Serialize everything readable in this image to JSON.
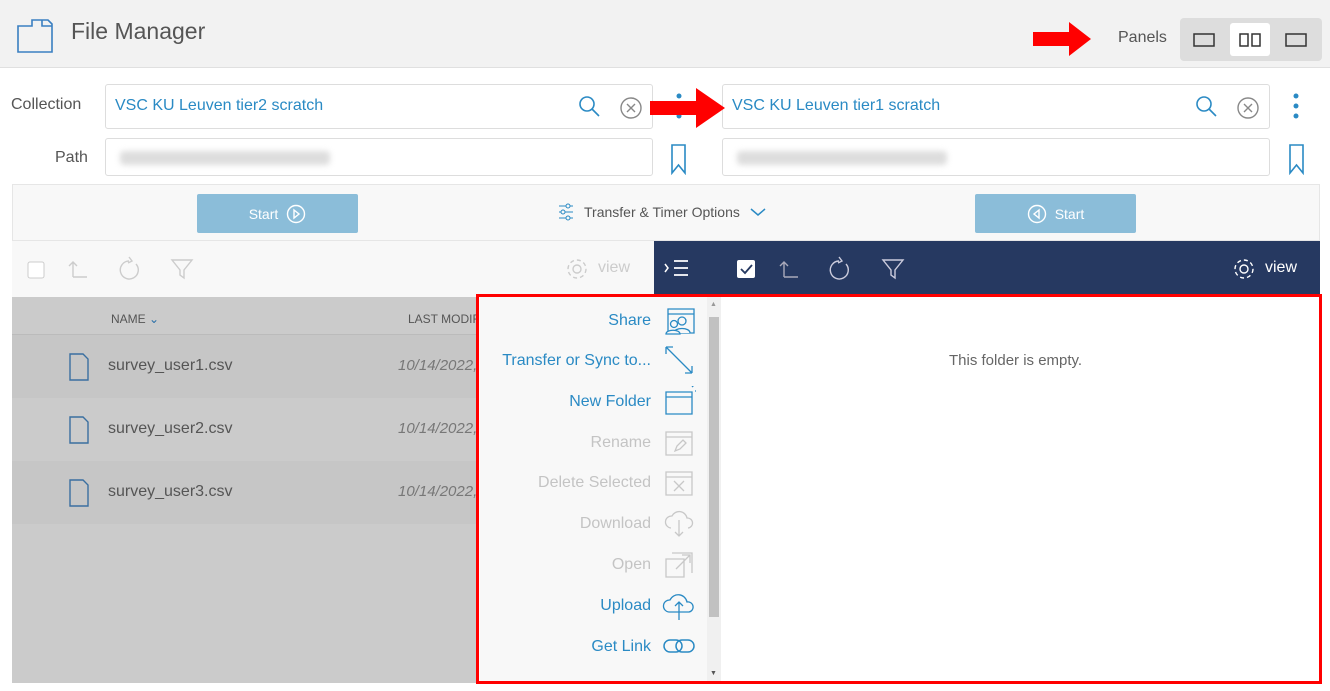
{
  "header": {
    "title": "File Manager",
    "panels_label": "Panels",
    "panel_modes": [
      "single-left",
      "dual",
      "single-right"
    ],
    "active_panel_mode": "dual"
  },
  "left": {
    "collection_label": "Collection",
    "collection": "VSC KU Leuven tier2 scratch",
    "path_label": "Path",
    "start_label": "Start",
    "toolbar": {
      "view_label": "view"
    },
    "columns": [
      "NAME",
      "LAST MODIF"
    ],
    "files": [
      {
        "name": "survey_user1.csv",
        "modified": "10/14/2022,"
      },
      {
        "name": "survey_user2.csv",
        "modified": "10/14/2022,"
      },
      {
        "name": "survey_user3.csv",
        "modified": "10/14/2022,"
      }
    ]
  },
  "transfer_options_label": "Transfer & Timer Options",
  "right": {
    "collection": "VSC KU Leuven tier1 scratch",
    "start_label": "Start",
    "toolbar": {
      "view_label": "view"
    },
    "empty_message": "This folder is empty."
  },
  "menu": [
    {
      "label": "Share",
      "enabled": true,
      "icon": "share-icon"
    },
    {
      "label": "Transfer or Sync to...",
      "enabled": true,
      "icon": "transfer-icon"
    },
    {
      "label": "New Folder",
      "enabled": true,
      "icon": "new-folder-icon"
    },
    {
      "label": "Rename",
      "enabled": false,
      "icon": "rename-icon"
    },
    {
      "label": "Delete Selected",
      "enabled": false,
      "icon": "delete-icon"
    },
    {
      "label": "Download",
      "enabled": false,
      "icon": "download-icon"
    },
    {
      "label": "Open",
      "enabled": false,
      "icon": "open-icon"
    },
    {
      "label": "Upload",
      "enabled": true,
      "icon": "upload-icon"
    },
    {
      "label": "Get Link",
      "enabled": true,
      "icon": "link-icon"
    }
  ],
  "colors": {
    "accent": "#2a8ac4",
    "toolbar_dark": "#263961",
    "start_button": "#8bbdd9",
    "annotation": "#ff0000"
  }
}
